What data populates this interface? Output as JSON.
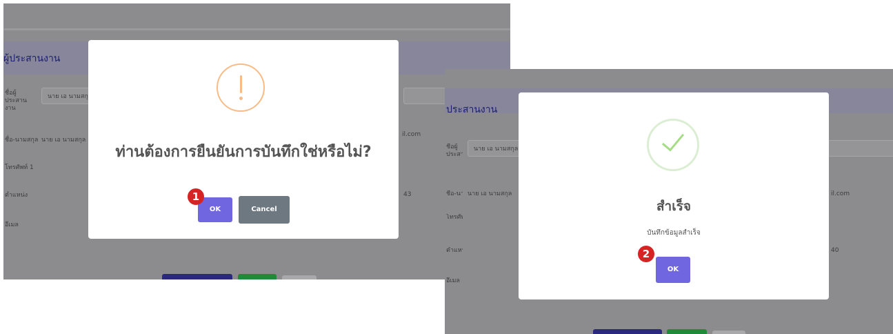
{
  "screen1": {
    "background": {
      "section_title": "ผู้ประสานงาน",
      "rows": [
        {
          "label": "ชื่อผู้ประสานงาน",
          "value": "นาย เอ นามสกุล"
        },
        {
          "label": "ชื่อ-นามสกุล",
          "value": "นาย เอ นามสกุล"
        },
        {
          "label": "โทรศัพท์ 1",
          "value": ""
        },
        {
          "label": "ตำแหน่ง",
          "value": ""
        },
        {
          "label": "อีเมล",
          "value": ""
        }
      ],
      "email_fragment": "il.com",
      "number_fragment": "43"
    },
    "dialog": {
      "icon": "warning-icon",
      "title": "ท่านต้องการยืนยันการบันทึกใช่หรือไม่?",
      "confirm_label": "OK",
      "cancel_label": "Cancel"
    },
    "step_badge": "1"
  },
  "screen2": {
    "background": {
      "section_title": "ประสานงาน",
      "rows": [
        {
          "label": "ชื่อผู้ประสานงาน",
          "value": "นาย เอ นามสกุล"
        },
        {
          "label": "ชื่อ-นามสกุล",
          "value": "นาย เอ นามสกุล"
        },
        {
          "label": "โทรศัพท์ 1",
          "value": ""
        },
        {
          "label": "ตำแหน่ง",
          "value": ""
        },
        {
          "label": "อีเมล",
          "value": ""
        }
      ],
      "email_fragment": "il.com",
      "number_fragment": "40"
    },
    "dialog": {
      "icon": "success-check-icon",
      "title": "สำเร็จ",
      "text": "บันทึกข้อมูลสำเร็จ",
      "confirm_label": "OK"
    },
    "step_badge": "2"
  },
  "colors": {
    "overlay": "#8c8c8f",
    "header_bar": "#87869a",
    "confirm_button": "#7066e0",
    "cancel_button": "#6e7881",
    "warning": "#f8bb86",
    "success": "#a5dc86",
    "badge": "#d62323",
    "bg_primary_button": "#2b2880",
    "bg_success_button": "#1f8a3a"
  }
}
